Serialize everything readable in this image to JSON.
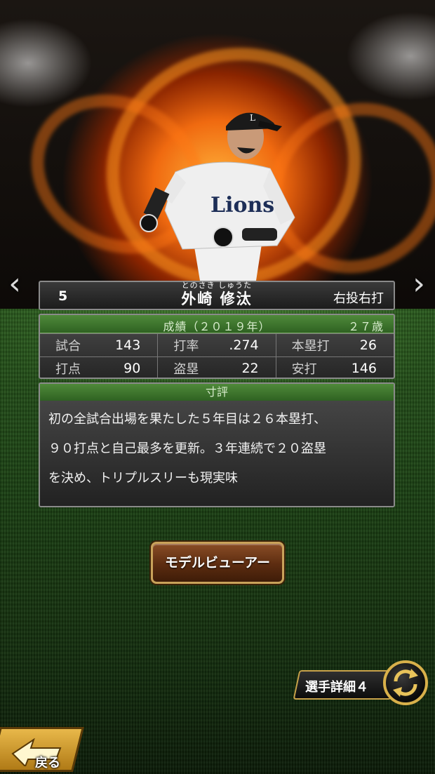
{
  "player": {
    "number": "5",
    "furigana": "とのさき しゅうた",
    "name": "外崎 修汰",
    "throw_bat": "右投右打"
  },
  "stats": {
    "title": "成績（２０１９年）",
    "age": "２７歳",
    "rows": [
      [
        {
          "label": "試合",
          "value": "143"
        },
        {
          "label": "打率",
          "value": ".274"
        },
        {
          "label": "本塁打",
          "value": "26"
        }
      ],
      [
        {
          "label": "打点",
          "value": "90"
        },
        {
          "label": "盗塁",
          "value": "22"
        },
        {
          "label": "安打",
          "value": "146"
        }
      ]
    ]
  },
  "comment": {
    "title": "寸評",
    "lines": [
      "初の全試合出場を果たした５年目は２６本塁打、",
      "９０打点と自己最多を更新。３年連続で２０盗塁",
      "を決め、トリプルスリーも現実味"
    ]
  },
  "buttons": {
    "model_viewer": "モデルビューアー",
    "player_detail": "選手詳細４",
    "back": "戻る"
  },
  "nav": {
    "prev": "‹",
    "next": "›"
  },
  "icons": {
    "back": "arrow-left-icon",
    "cycle": "cycle-arrows-icon"
  },
  "colors": {
    "accent_green": "#4f8a3a",
    "gold": "#c9a25a"
  }
}
